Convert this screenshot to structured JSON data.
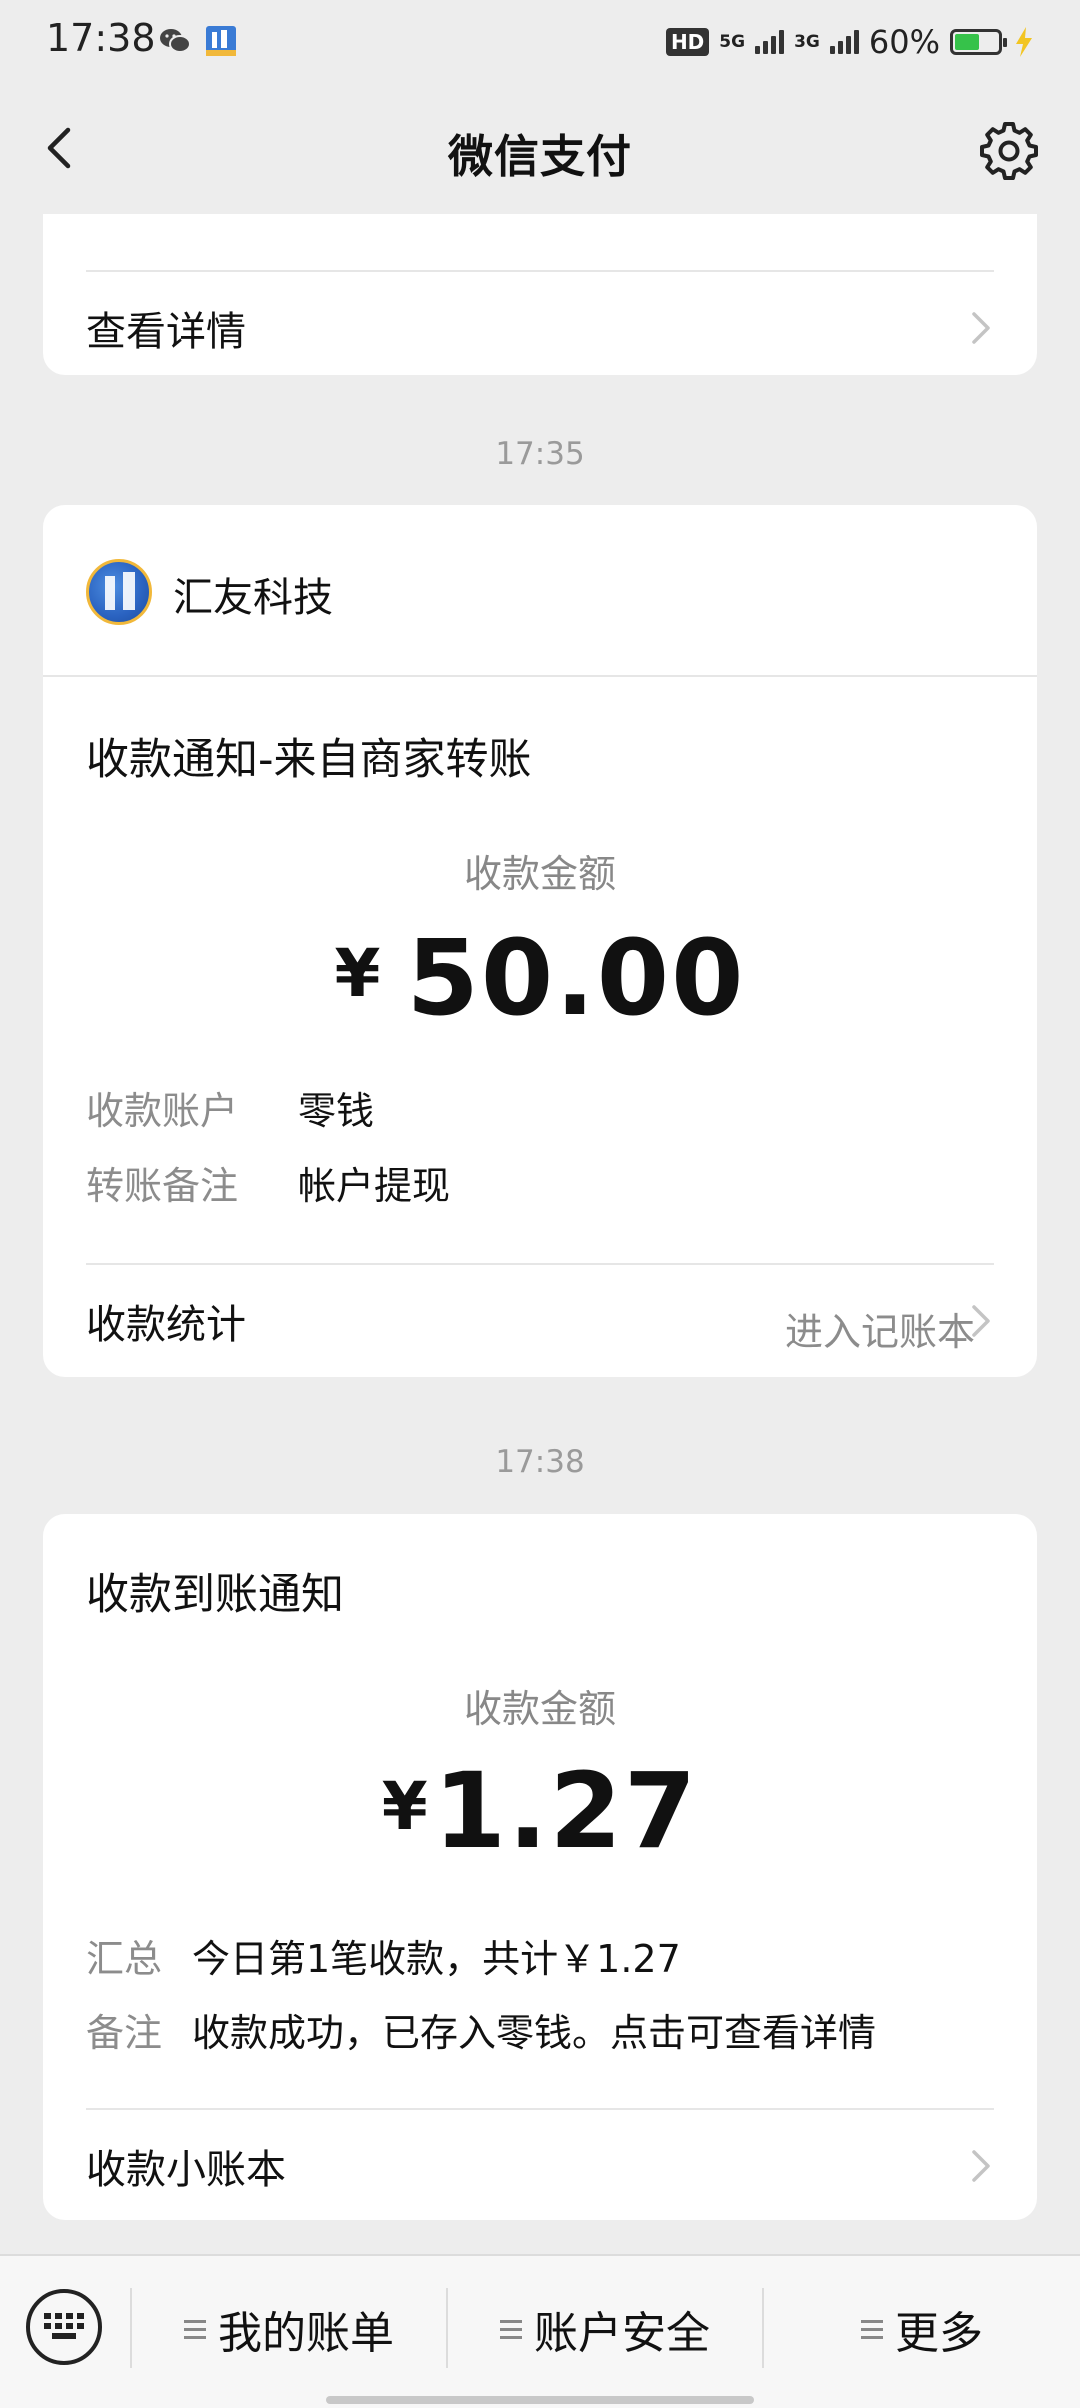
{
  "status_bar": {
    "time": "17:38",
    "network_1": "5G",
    "network_2": "3G",
    "battery_percent": "60%",
    "battery_level": 0.6,
    "icons": [
      "wechat-icon",
      "app-icon",
      "hd-icon",
      "signal-icon",
      "battery-icon",
      "charging-icon"
    ]
  },
  "nav": {
    "title": "微信支付",
    "back_icon": "chevron-left-icon",
    "settings_icon": "gear-icon"
  },
  "messages": [
    {
      "type": "partial",
      "link_label": "查看详情"
    },
    {
      "time": "17:35",
      "merchant": "汇友科技",
      "title": "收款通知-来自商家转账",
      "amount_label": "收款金额",
      "currency": "¥",
      "amount": "50.00",
      "details": [
        {
          "key": "收款账户",
          "value": "零钱"
        },
        {
          "key": "转账备注",
          "value": "帐户提现"
        }
      ],
      "footer_label": "收款统计",
      "footer_link": "进入记账本"
    },
    {
      "time": "17:38",
      "title": "收款到账通知",
      "amount_label": "收款金额",
      "currency": "¥",
      "amount": "1.27",
      "details": [
        {
          "key": "汇总",
          "value": "今日第1笔收款，共计￥1.27"
        },
        {
          "key": "备注",
          "value": "收款成功，已存入零钱。点击可查看详情"
        }
      ],
      "footer_label": "收款小账本"
    }
  ],
  "bottom_bar": {
    "keyboard_icon": "keyboard-icon",
    "tabs": [
      "我的账单",
      "账户安全",
      "更多"
    ]
  },
  "colors": {
    "background": "#ededed",
    "card": "#ffffff",
    "secondary_text": "#8c8c8c",
    "battery_green": "#36c24a",
    "charging_yellow": "#f2c522"
  }
}
